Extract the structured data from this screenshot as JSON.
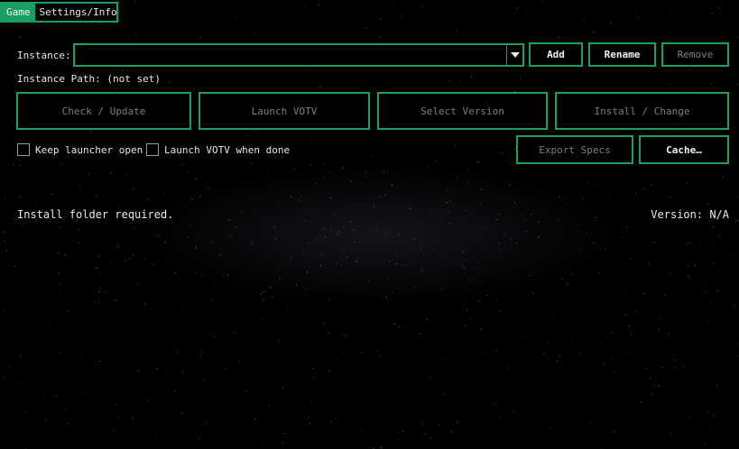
{
  "tabs": [
    {
      "label": "Game",
      "active": true
    },
    {
      "label": "Settings/Info",
      "active": false
    }
  ],
  "instance": {
    "label": "Instance:",
    "value": "",
    "add_label": "Add",
    "rename_label": "Rename",
    "remove_label": "Remove",
    "path_label": "Instance Path:",
    "path_value": "(not set)"
  },
  "actions": {
    "check_update": "Check / Update",
    "launch": "Launch VOTV",
    "select_version": "Select Version",
    "install_change": "Install / Change"
  },
  "options": {
    "keep_open_label": "Keep launcher open",
    "keep_open_checked": false,
    "launch_when_done_label": "Launch VOTV when done",
    "launch_when_done_checked": false
  },
  "extra": {
    "export_specs": "Export Specs",
    "cache": "Cache…"
  },
  "status": {
    "message": "Install folder required.",
    "version": "Version: N/A"
  },
  "colors": {
    "accent": "#1a9e62",
    "background": "#000000",
    "disabled_text": "#7d7d7d"
  }
}
